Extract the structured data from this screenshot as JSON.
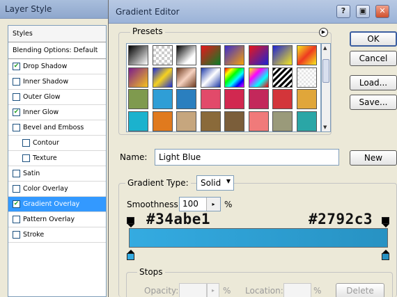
{
  "layer_style": {
    "title": "Layer Style",
    "styles_header": "Styles",
    "blending_options": "Blending Options: Default",
    "items": [
      {
        "label": "Drop Shadow",
        "checked": true,
        "indent": false,
        "selected": false
      },
      {
        "label": "Inner Shadow",
        "checked": false,
        "indent": false,
        "selected": false
      },
      {
        "label": "Outer Glow",
        "checked": false,
        "indent": false,
        "selected": false
      },
      {
        "label": "Inner Glow",
        "checked": true,
        "indent": false,
        "selected": false
      },
      {
        "label": "Bevel and Emboss",
        "checked": false,
        "indent": false,
        "selected": false
      },
      {
        "label": "Contour",
        "checked": false,
        "indent": true,
        "selected": false
      },
      {
        "label": "Texture",
        "checked": false,
        "indent": true,
        "selected": false
      },
      {
        "label": "Satin",
        "checked": false,
        "indent": false,
        "selected": false
      },
      {
        "label": "Color Overlay",
        "checked": false,
        "indent": false,
        "selected": false
      },
      {
        "label": "Gradient Overlay",
        "checked": true,
        "indent": false,
        "selected": true
      },
      {
        "label": "Pattern Overlay",
        "checked": false,
        "indent": false,
        "selected": false
      },
      {
        "label": "Stroke",
        "checked": false,
        "indent": false,
        "selected": false
      }
    ]
  },
  "gradient_editor": {
    "title": "Gradient Editor",
    "window_buttons": {
      "help": "?",
      "maximize": "▣",
      "close": "✕"
    },
    "presets_label": "Presets",
    "presets_menu_icon": "play-circle-icon",
    "swatch_rows": [
      [
        "linear-gradient(135deg,#000,#fff)",
        "checker-white",
        "linear-gradient(135deg,#000,#fff 70%)",
        "linear-gradient(135deg,#e8161b,#0a7e26)",
        "linear-gradient(135deg,#3b2ccc,#f6a10a)",
        "linear-gradient(135deg,#e8161b,#1e23d3)",
        "linear-gradient(135deg,#1e23d3,#f6e91f)",
        "linear-gradient(135deg,#f6e91f,#ee3a20,#f6e91f)"
      ],
      [
        "linear-gradient(135deg,#7a1c8c,#f6c21f)",
        "linear-gradient(135deg,#1b2ed8,#f6d21f,#1b2ed8)",
        "linear-gradient(135deg,#6d3a1f,#f6d2c0,#6d3a1f)",
        "linear-gradient(135deg,#1e3aa8,#fff,#1e3aa8)",
        "linear-gradient(135deg,#f00,#ff0,#0f0,#0ff,#00f,#f0f)",
        "linear-gradient(135deg,#ff0,#f0f,#0ff,#f00)",
        "stripes",
        "checker-color"
      ],
      [
        "#7f9a4e",
        "#2f9ed6",
        "#2a7fbf",
        "#e24a6a",
        "#d12850",
        "#c3285b",
        "#d3353a",
        "#e0a63a"
      ],
      [
        "#1bb2ce",
        "#e07a1e",
        "#c6a67e",
        "#8a6a3a",
        "#7b5e3a",
        "#f07a7a",
        "#9a9a7a",
        "#2aa6a6"
      ]
    ],
    "buttons": {
      "ok": "OK",
      "cancel": "Cancel",
      "load": "Load...",
      "save": "Save...",
      "new": "New"
    },
    "name_label": "Name:",
    "name_value": "Light Blue",
    "gradient_type_label": "Gradient Type:",
    "gradient_type_value": "Solid",
    "smoothness_label": "Smoothness:",
    "smoothness_value": "100",
    "smoothness_unit": "%",
    "gradient_start_color": "#34abe1",
    "gradient_end_color": "#2792c3",
    "annotation_left": "#34abe1",
    "annotation_right": "#2792c3",
    "stops_label": "Stops",
    "opacity_label": "Opacity:",
    "opacity_unit": "%",
    "location_label": "Location:",
    "location_unit": "%",
    "delete_label": "Delete"
  }
}
